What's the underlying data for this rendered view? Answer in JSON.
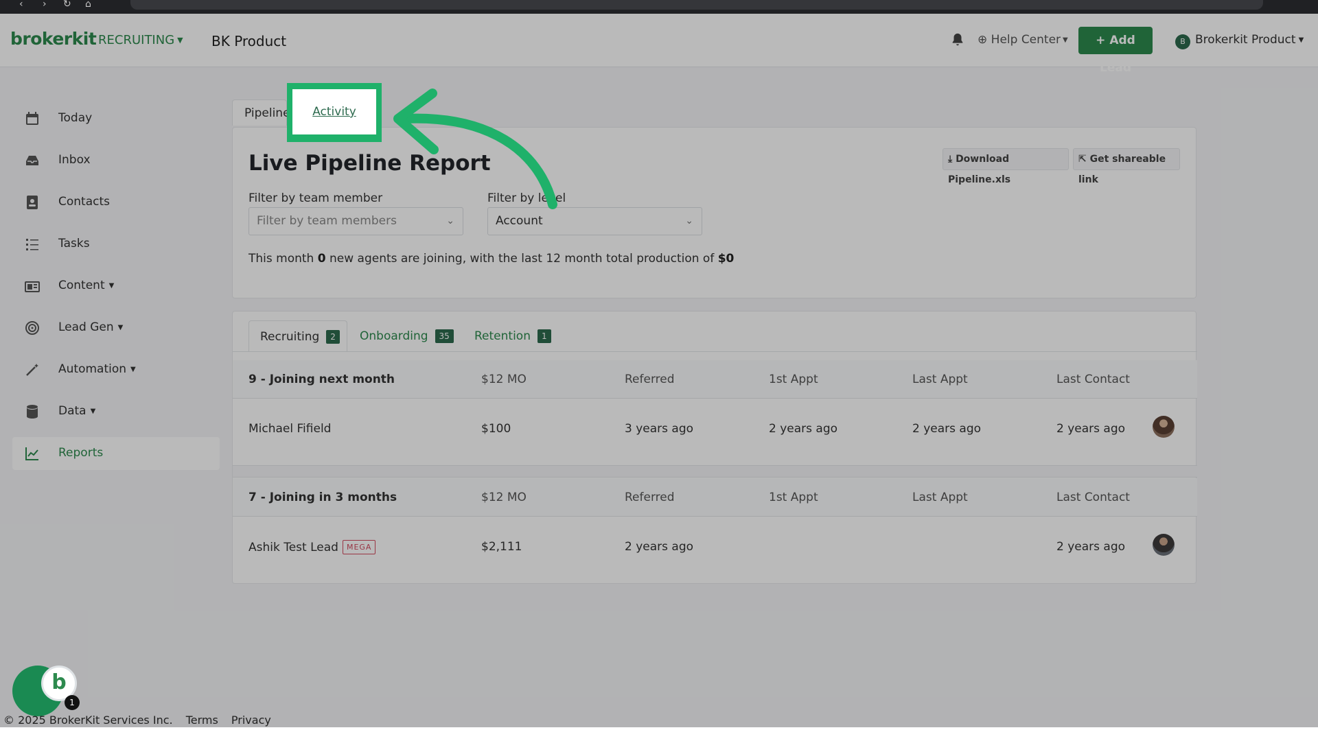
{
  "header": {
    "logo": "brokerkit",
    "module": "RECRUITING",
    "product_title": "BK Product",
    "help": "Help Center",
    "add_lead": "+ Add Lead",
    "user_initial": "B",
    "user_name": "Brokerkit Product"
  },
  "sidebar": {
    "items": [
      {
        "label": "Today",
        "icon": "calendar-icon"
      },
      {
        "label": "Inbox",
        "icon": "inbox-icon"
      },
      {
        "label": "Contacts",
        "icon": "contact-card-icon"
      },
      {
        "label": "Tasks",
        "icon": "task-list-icon"
      },
      {
        "label": "Content",
        "icon": "content-icon"
      },
      {
        "label": "Lead Gen",
        "icon": "lead-gen-icon"
      },
      {
        "label": "Automation",
        "icon": "magic-wand-icon"
      },
      {
        "label": "Data",
        "icon": "database-icon"
      },
      {
        "label": "Reports",
        "icon": "line-chart-icon"
      }
    ]
  },
  "tabs": {
    "pipeline": "Pipeline",
    "activity": "Activity"
  },
  "report": {
    "title": "Live Pipeline Report",
    "download": "Download Pipeline.xls",
    "share": "Get shareable link",
    "filter_member_label": "Filter by team member",
    "filter_member_placeholder": "Filter by team members",
    "filter_level_label": "Filter by level",
    "filter_level_value": "Account",
    "summary_pre": "This month",
    "summary_new": "0",
    "summary_mid": "new agents are joining, with the last 12 month total production of",
    "summary_total": "$0"
  },
  "pipeline": {
    "tabs": [
      {
        "label": "Recruiting",
        "count": "2"
      },
      {
        "label": "Onboarding",
        "count": "35"
      },
      {
        "label": "Retention",
        "count": "1"
      }
    ],
    "columns": [
      "$12 MO",
      "Referred",
      "1st Appt",
      "Last Appt",
      "Last Contact"
    ],
    "groups": [
      {
        "title": "9 - Joining next month",
        "rows": [
          {
            "name": "Michael Fifield",
            "badge": "",
            "mo12": "$100",
            "referred": "3 years ago",
            "first_appt": "2 years ago",
            "last_appt": "2 years ago",
            "last_contact": "2 years ago"
          }
        ]
      },
      {
        "title": "7 - Joining in 3 months",
        "rows": [
          {
            "name": "Ashik Test Lead",
            "badge": "MEGA",
            "mo12": "$2,111",
            "referred": "2 years ago",
            "first_appt": "",
            "last_appt": "",
            "last_contact": "2 years ago"
          }
        ]
      }
    ]
  },
  "chat": {
    "logo": "b",
    "count": "1"
  },
  "footer": {
    "copyright": "© 2025 BrokerKit Services Inc.",
    "terms": "Terms",
    "privacy": "Privacy"
  },
  "colors": {
    "brand": "#2d8a4e",
    "highlight": "#1fb16a",
    "badge_dark": "#2d6a4e",
    "mega": "#d2495e"
  }
}
